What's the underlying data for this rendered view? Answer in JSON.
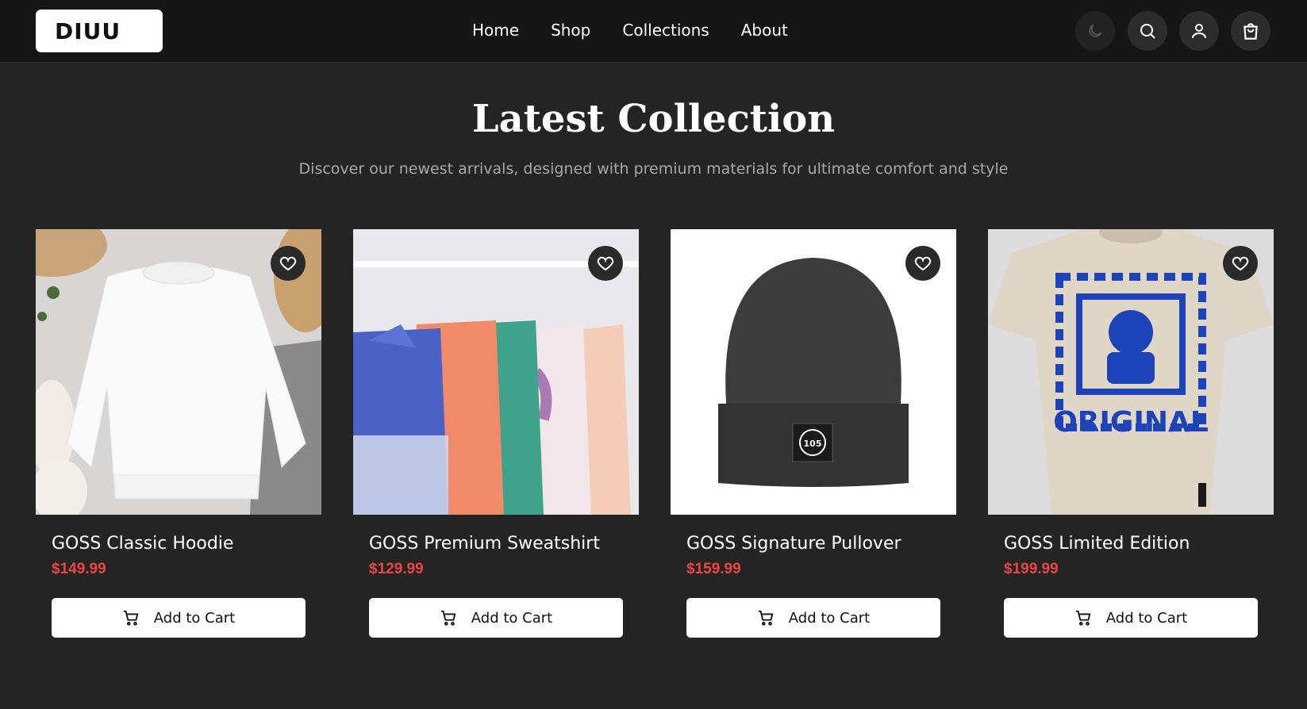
{
  "header": {
    "logo": "DIUU",
    "nav": [
      "Home",
      "Shop",
      "Collections",
      "About"
    ],
    "icons": [
      "moon-icon",
      "search-icon",
      "user-icon",
      "shopping-bag-icon"
    ]
  },
  "hero": {
    "title": "Latest Collection",
    "subtitle": "Discover our newest arrivals, designed with premium materials for ultimate comfort and style"
  },
  "products": [
    {
      "name": "GOSS Classic Hoodie",
      "price": "$149.99",
      "cta": "Add to Cart"
    },
    {
      "name": "GOSS Premium Sweatshirt",
      "price": "$129.99",
      "cta": "Add to Cart"
    },
    {
      "name": "GOSS Signature Pullover",
      "price": "$159.99",
      "cta": "Add to Cart"
    },
    {
      "name": "GOSS Limited Edition",
      "price": "$199.99",
      "cta": "Add to Cart"
    }
  ],
  "product_images": {
    "tshirt_print_text": "ORIGINAL",
    "beanie_patch_text": "105"
  },
  "colors": {
    "background": "#242424",
    "header": "#151515",
    "price": "#ef4444",
    "button": "#ffffff"
  }
}
